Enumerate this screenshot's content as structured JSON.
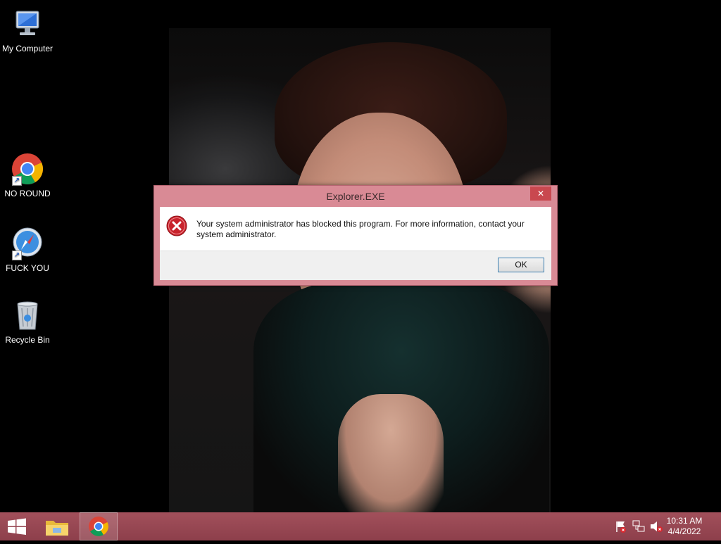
{
  "desktop": {
    "icons": [
      {
        "label": "My Computer",
        "icon": "computer-icon"
      },
      {
        "label": "NO ROUND",
        "icon": "chrome-icon"
      },
      {
        "label": "FUCK YOU",
        "icon": "safari-icon"
      },
      {
        "label": "Recycle Bin",
        "icon": "recycle-bin-icon"
      }
    ]
  },
  "dialog": {
    "title": "Explorer.EXE",
    "close_glyph": "✕",
    "message": "Your system administrator has blocked this program. For more information, contact your system administrator.",
    "ok_label": "OK",
    "icon": "error-icon",
    "accent": "#d98a95"
  },
  "taskbar": {
    "color": "#964653",
    "apps": [
      {
        "icon": "windows-start-icon"
      },
      {
        "icon": "file-explorer-icon"
      },
      {
        "icon": "chrome-icon"
      }
    ],
    "tray": {
      "icons": [
        "action-center-flag-icon",
        "network-icon",
        "volume-muted-icon"
      ],
      "time": "10:31 AM",
      "date": "4/4/2022"
    }
  }
}
